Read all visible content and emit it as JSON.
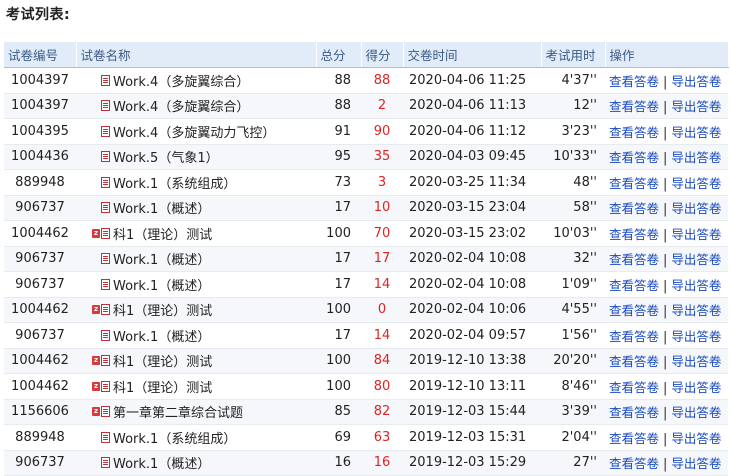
{
  "page_title": "考试列表:",
  "columns": {
    "id": "试卷编号",
    "name": "试卷名称",
    "total": "总分",
    "score": "得分",
    "submit_time": "交卷时间",
    "duration": "考试用时",
    "ops": "操作"
  },
  "ops": {
    "view": "查看答卷",
    "separator": "|",
    "export": "导出答卷"
  },
  "colors": {
    "score": "#e02323",
    "link": "#1a4bc0",
    "header_bg": "#e1ecf8"
  },
  "rows": [
    {
      "id": "1004397",
      "name": "Work.4（多旋翼综合）",
      "total": "88",
      "score": "88",
      "time": "2020-04-06 11:25",
      "duration": "4'37''",
      "icons": [
        "doc-icon"
      ]
    },
    {
      "id": "1004397",
      "name": "Work.4（多旋翼综合）",
      "total": "88",
      "score": "2",
      "time": "2020-04-06 11:13",
      "duration": "12''",
      "icons": [
        "doc-icon"
      ]
    },
    {
      "id": "1004395",
      "name": "Work.4（多旋翼动力飞控）",
      "total": "91",
      "score": "90",
      "time": "2020-04-06 11:12",
      "duration": "3'23''",
      "icons": [
        "doc-icon"
      ]
    },
    {
      "id": "1004436",
      "name": "Work.5（气象1）",
      "total": "95",
      "score": "35",
      "time": "2020-04-03 09:45",
      "duration": "10'33''",
      "icons": [
        "doc-icon"
      ]
    },
    {
      "id": "889948",
      "name": "Work.1（系统组成）",
      "total": "73",
      "score": "3",
      "time": "2020-03-25 11:34",
      "duration": "48''",
      "icons": [
        "doc-icon"
      ]
    },
    {
      "id": "906737",
      "name": "Work.1（概述）",
      "total": "17",
      "score": "10",
      "time": "2020-03-15 23:04",
      "duration": "58''",
      "icons": [
        "doc-icon"
      ]
    },
    {
      "id": "1004462",
      "name": "科1（理论）测试",
      "total": "100",
      "score": "70",
      "time": "2020-03-15 23:02",
      "duration": "10'03''",
      "icons": [
        "z-icon",
        "doc-icon"
      ]
    },
    {
      "id": "906737",
      "name": "Work.1（概述）",
      "total": "17",
      "score": "17",
      "time": "2020-02-04 10:08",
      "duration": "32''",
      "icons": [
        "doc-icon"
      ]
    },
    {
      "id": "906737",
      "name": "Work.1（概述）",
      "total": "17",
      "score": "14",
      "time": "2020-02-04 10:08",
      "duration": "1'09''",
      "icons": [
        "doc-icon"
      ]
    },
    {
      "id": "1004462",
      "name": "科1（理论）测试",
      "total": "100",
      "score": "0",
      "time": "2020-02-04 10:06",
      "duration": "4'55''",
      "icons": [
        "z-icon",
        "doc-icon"
      ]
    },
    {
      "id": "906737",
      "name": "Work.1（概述）",
      "total": "17",
      "score": "14",
      "time": "2020-02-04 09:57",
      "duration": "1'56''",
      "icons": [
        "doc-icon"
      ]
    },
    {
      "id": "1004462",
      "name": "科1（理论）测试",
      "total": "100",
      "score": "84",
      "time": "2019-12-10 13:38",
      "duration": "20'20''",
      "icons": [
        "z-icon",
        "doc-icon"
      ]
    },
    {
      "id": "1004462",
      "name": "科1（理论）测试",
      "total": "100",
      "score": "80",
      "time": "2019-12-10 13:11",
      "duration": "8'46''",
      "icons": [
        "z-icon",
        "doc-icon"
      ]
    },
    {
      "id": "1156606",
      "name": "第一章第二章综合试题",
      "total": "85",
      "score": "82",
      "time": "2019-12-03 15:44",
      "duration": "3'39''",
      "icons": [
        "z-icon",
        "doc-icon"
      ]
    },
    {
      "id": "889948",
      "name": "Work.1（系统组成）",
      "total": "69",
      "score": "63",
      "time": "2019-12-03 15:31",
      "duration": "2'04''",
      "icons": [
        "doc-icon"
      ]
    },
    {
      "id": "906737",
      "name": "Work.1（概述）",
      "total": "16",
      "score": "16",
      "time": "2019-12-03 15:29",
      "duration": "27''",
      "icons": [
        "doc-icon"
      ]
    }
  ]
}
